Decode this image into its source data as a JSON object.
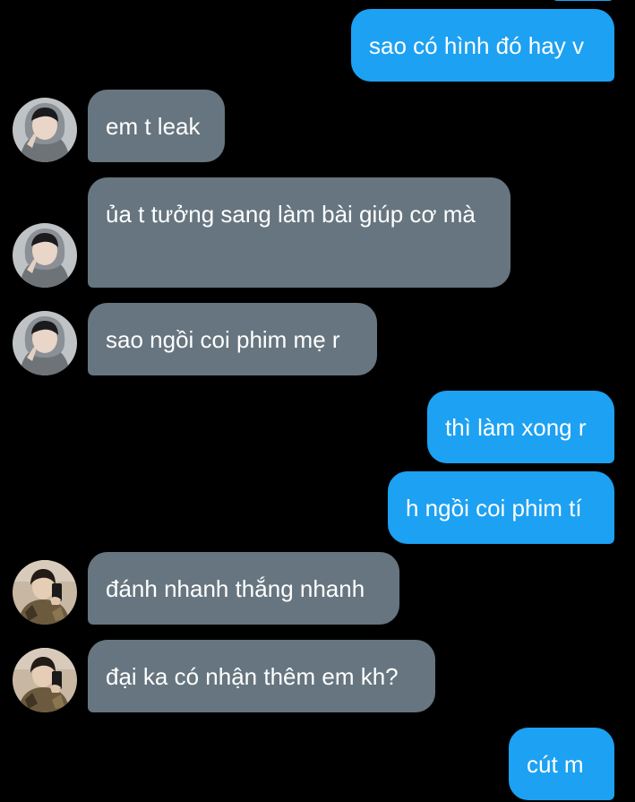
{
  "conversation": {
    "messages": [
      {
        "direction": "outgoing",
        "text": "sao có hình đó hay v"
      },
      {
        "direction": "incoming",
        "avatar": "avatar-hoodie",
        "text": "em t leak"
      },
      {
        "direction": "incoming",
        "avatar": "avatar-hoodie",
        "text": "ủa t tưởng sang làm bài giúp cơ mà"
      },
      {
        "direction": "incoming",
        "avatar": "avatar-hoodie",
        "text": "sao ngồi coi phim mẹ r"
      },
      {
        "direction": "outgoing",
        "text": "thì làm xong r"
      },
      {
        "direction": "outgoing",
        "text": "h ngồi coi phim tí"
      },
      {
        "direction": "incoming",
        "avatar": "avatar-mirror-selfie",
        "text": "đánh nhanh thắng nhanh"
      },
      {
        "direction": "incoming",
        "avatar": "avatar-mirror-selfie",
        "text": "đại ka có nhận thêm em kh?"
      },
      {
        "direction": "outgoing",
        "text": "cút m"
      }
    ]
  },
  "colors": {
    "background": "#000000",
    "outgoing_bubble": "#1da1f2",
    "incoming_bubble": "#66757f",
    "text": "#ffffff"
  }
}
